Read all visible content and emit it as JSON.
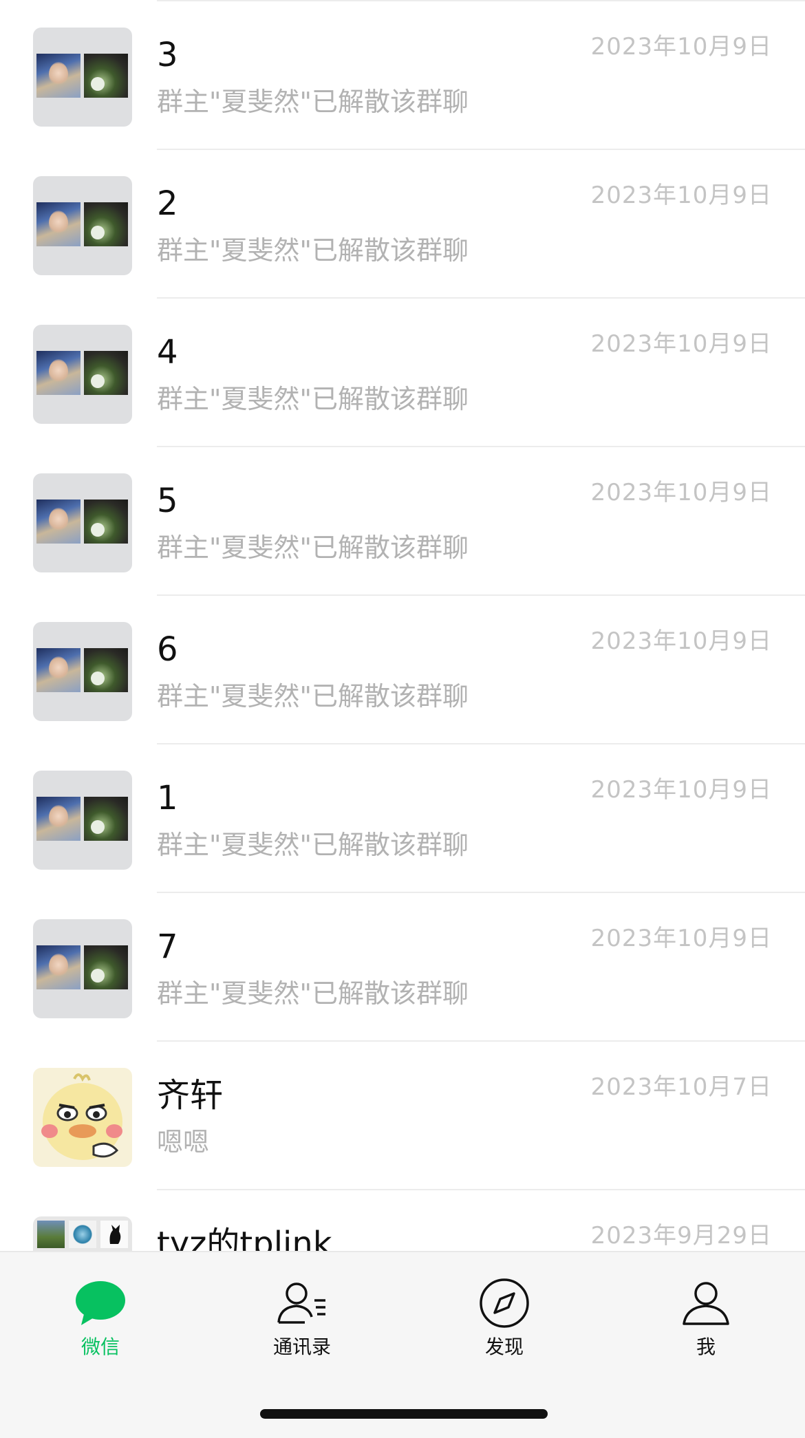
{
  "chats": [
    {
      "title": "3",
      "preview": "群主\"夏斐然\"已解散该群聊",
      "time": "2023年10月9日",
      "avatar": "group-photo-grid"
    },
    {
      "title": "2",
      "preview": "群主\"夏斐然\"已解散该群聊",
      "time": "2023年10月9日",
      "avatar": "group-photo-grid"
    },
    {
      "title": "4",
      "preview": "群主\"夏斐然\"已解散该群聊",
      "time": "2023年10月9日",
      "avatar": "group-photo-grid"
    },
    {
      "title": "5",
      "preview": "群主\"夏斐然\"已解散该群聊",
      "time": "2023年10月9日",
      "avatar": "group-photo-grid"
    },
    {
      "title": "6",
      "preview": "群主\"夏斐然\"已解散该群聊",
      "time": "2023年10月9日",
      "avatar": "group-photo-grid"
    },
    {
      "title": "1",
      "preview": "群主\"夏斐然\"已解散该群聊",
      "time": "2023年10月9日",
      "avatar": "group-photo-grid"
    },
    {
      "title": "7",
      "preview": "群主\"夏斐然\"已解散该群聊",
      "time": "2023年10月9日",
      "avatar": "group-photo-grid"
    },
    {
      "title": "齐轩",
      "preview": "嗯嗯",
      "time": "2023年10月7日",
      "avatar": "yellow-duck-sticker"
    },
    {
      "title": "tyz的tplink",
      "preview": "",
      "time": "2023年9月29日",
      "avatar": "group-photo-grid-multi"
    }
  ],
  "tabbar": {
    "tabs": [
      {
        "label": "微信",
        "icon": "chat-bubble-icon",
        "active": true
      },
      {
        "label": "通讯录",
        "icon": "contacts-icon",
        "active": false
      },
      {
        "label": "发现",
        "icon": "compass-icon",
        "active": false
      },
      {
        "label": "我",
        "icon": "person-icon",
        "active": false
      }
    ]
  },
  "colors": {
    "accent": "#07c160",
    "title_text": "#111111",
    "preview_text": "#b2b2b2",
    "time_text": "#c4c4c4",
    "tabbar_bg": "#f6f6f6",
    "avatar_bg": "#dedfe1"
  }
}
